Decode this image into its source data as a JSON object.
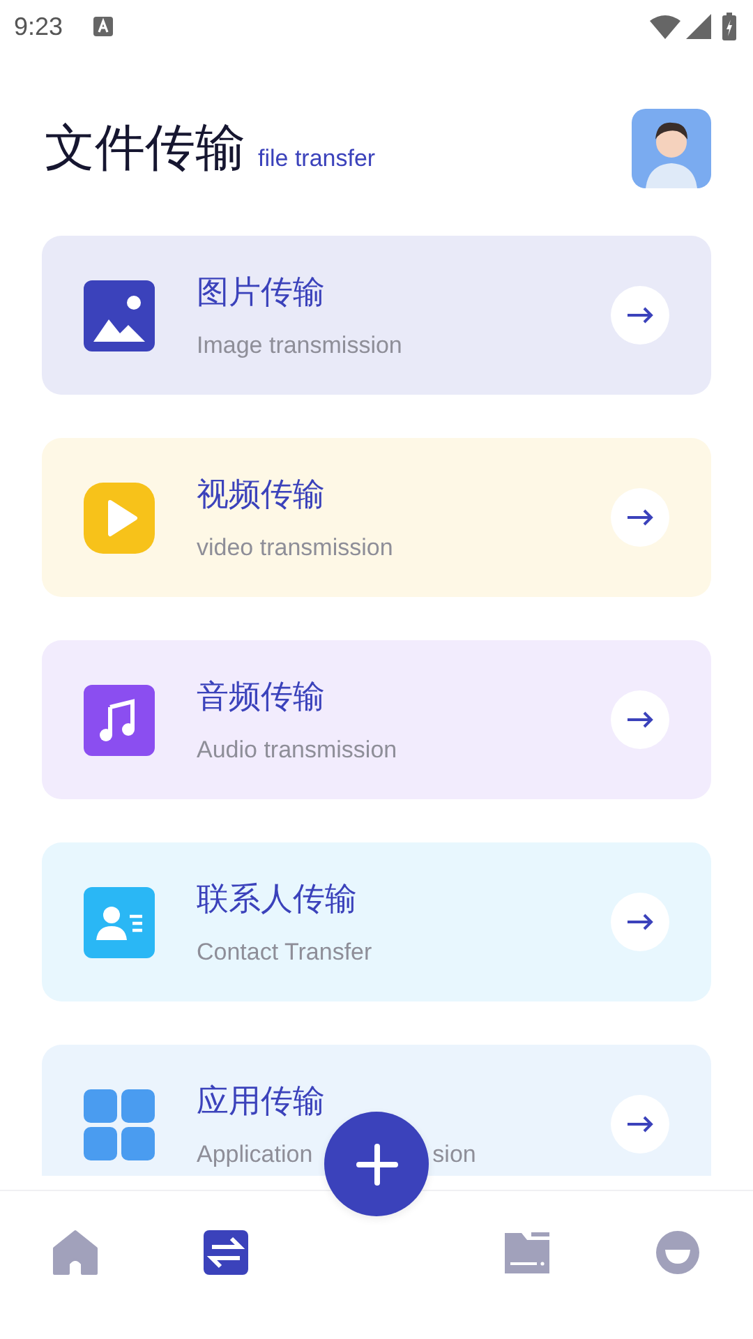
{
  "status_bar": {
    "time": "9:23"
  },
  "header": {
    "title": "文件传输",
    "subtitle": "file transfer"
  },
  "cards": [
    {
      "kind": "image",
      "title": "图片传输",
      "subtitle": "Image transmission",
      "color": "#3b42bb"
    },
    {
      "kind": "video",
      "title": "视频传输",
      "subtitle": "video transmission",
      "color": "#f7c21a"
    },
    {
      "kind": "audio",
      "title": "音频传输",
      "subtitle": "Audio transmission",
      "color": "#8b4ef0"
    },
    {
      "kind": "contact",
      "title": "联系人传输",
      "subtitle": "Contact Transfer",
      "color": "#2ab7f5"
    },
    {
      "kind": "apps",
      "title": "应用传输",
      "subtitle": "Application",
      "subtitle_tail": "sion",
      "color": "#4a9cf0"
    }
  ],
  "bottom_nav": [
    {
      "kind": "home",
      "selected": false
    },
    {
      "kind": "transfer",
      "selected": true
    },
    {
      "kind": "add",
      "selected": false
    },
    {
      "kind": "folder",
      "selected": false
    },
    {
      "kind": "profile",
      "selected": false
    }
  ]
}
